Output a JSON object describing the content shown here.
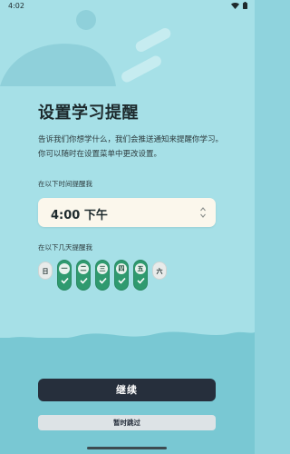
{
  "status_bar": {
    "time": "4:02",
    "icons": [
      "wifi-icon",
      "battery-icon"
    ]
  },
  "page": {
    "title": "设置学习提醒",
    "description": "告诉我们你想学什么，我们会推送通知来提醒你学习。你可以随时在设置菜单中更改设置。"
  },
  "time_section": {
    "label": "在以下时间提醒我",
    "value": "4:00 下午"
  },
  "days_section": {
    "label": "在以下几天提醒我",
    "days": [
      {
        "char": "日",
        "selected": false
      },
      {
        "char": "一",
        "selected": true
      },
      {
        "char": "二",
        "selected": true
      },
      {
        "char": "三",
        "selected": true
      },
      {
        "char": "四",
        "selected": true
      },
      {
        "char": "五",
        "selected": true
      },
      {
        "char": "六",
        "selected": false
      }
    ]
  },
  "actions": {
    "continue_label": "继续",
    "skip_label": "暂时跳过"
  },
  "colors": {
    "background_top": "#a6e0e7",
    "background_bottom": "#79c8d3",
    "selected_day": "#2f9a6f",
    "primary_button": "#262f3c"
  }
}
